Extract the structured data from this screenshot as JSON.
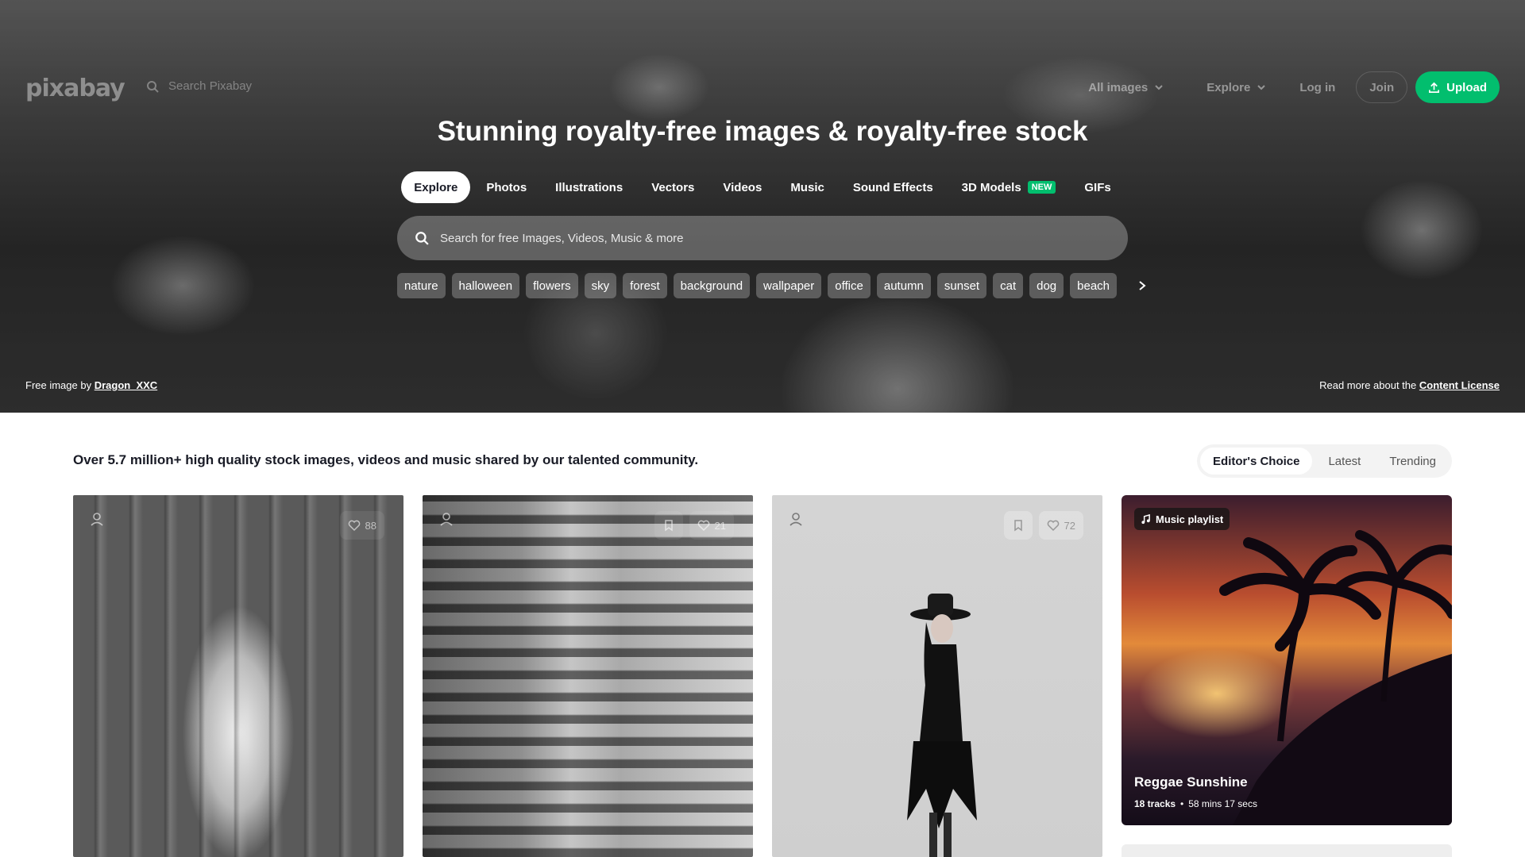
{
  "brand": {
    "logo_text": "pixabay",
    "accent": "#02be6e"
  },
  "topbar": {
    "search_placeholder": "Search Pixabay",
    "all_images_label": "All images",
    "explore_label": "Explore",
    "login_label": "Log in",
    "join_label": "Join",
    "upload_label": "Upload"
  },
  "hero": {
    "title": "Stunning royalty-free images & royalty-free stock",
    "tabs": [
      {
        "label": "Explore",
        "active": true
      },
      {
        "label": "Photos"
      },
      {
        "label": "Illustrations"
      },
      {
        "label": "Vectors"
      },
      {
        "label": "Videos"
      },
      {
        "label": "Music"
      },
      {
        "label": "Sound Effects"
      },
      {
        "label": "3D Models",
        "badge": "NEW"
      },
      {
        "label": "GIFs"
      }
    ],
    "search_placeholder": "Search for free Images, Videos, Music & more",
    "chips": [
      "nature",
      "halloween",
      "flowers",
      "sky",
      "forest",
      "background",
      "wallpaper",
      "office",
      "autumn",
      "sunset",
      "cat",
      "dog",
      "beach"
    ],
    "credit_prefix": "Free image by",
    "credit_author": "Dragon_XXC",
    "license_prefix": "Read more about the",
    "license_link": "Content License"
  },
  "content": {
    "tagline": "Over 5.7 million+ high quality stock images, videos and music shared by our talented community.",
    "sort_tabs": [
      {
        "label": "Editor's Choice",
        "active": true
      },
      {
        "label": "Latest"
      },
      {
        "label": "Trending"
      }
    ],
    "cards": [
      {
        "likes": "88"
      },
      {
        "likes": "21"
      },
      {
        "likes": "72"
      }
    ],
    "playlist": {
      "badge": "Music playlist",
      "title": "Reggae Sunshine",
      "tracks": "18 tracks",
      "duration": "58 mins 17 secs"
    }
  },
  "icons": [
    "search-icon",
    "chevron-down-icon",
    "upload-icon",
    "chevron-right-icon",
    "bookmark-icon",
    "heart-icon",
    "user-icon",
    "music-note-icon"
  ]
}
